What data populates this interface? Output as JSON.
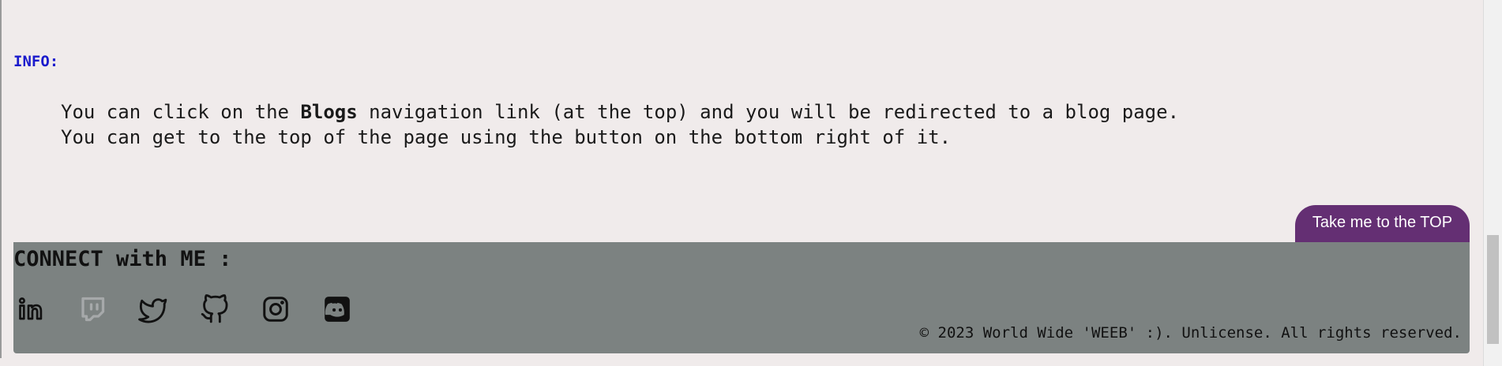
{
  "info": {
    "label": "INFO:",
    "line1_prefix": "You can click on the ",
    "line1_bold": "Blogs",
    "line1_suffix": " navigation link (at the top) and you will be redirected to a blog page.",
    "line2": "You can get to the top of the page using the button on the bottom right of it."
  },
  "top_button": {
    "label": "Take me to the TOP"
  },
  "footer": {
    "title": "CONNECT with ME :",
    "social": [
      {
        "icon": "linkedin-icon"
      },
      {
        "icon": "twitch-icon"
      },
      {
        "icon": "twitter-icon"
      },
      {
        "icon": "github-icon"
      },
      {
        "icon": "instagram-icon"
      },
      {
        "icon": "discord-icon"
      }
    ],
    "copyright": "© 2023 World Wide 'WEEB' :). Unlicense. All rights reserved."
  },
  "colors": {
    "background": "#f0ebeb",
    "footer": "#7c8281",
    "button": "#642f73",
    "info_label": "#1a1acc"
  }
}
